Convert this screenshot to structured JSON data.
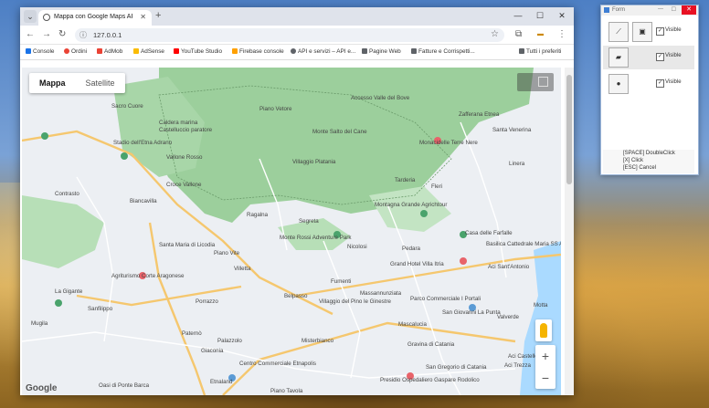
{
  "browser": {
    "tab_title": "Mappa con Google Maps API c",
    "url": "127.0.0.1",
    "bookmarks": [
      "Console",
      "Ordini",
      "AdMob",
      "AdSense",
      "YouTube Studio",
      "Firebase console",
      "API e servizi – API e...",
      "Pagine Web",
      "Fatture e Corrispetti...",
      "Tutti i preferiti"
    ],
    "bookmark_colors": [
      "#1a73e8",
      "#ea4335",
      "#ea4335",
      "#fbbc04",
      "#ff0000",
      "#ffa000",
      "#5f6368",
      "#5f6368",
      "#5f6368",
      "#5f6368"
    ]
  },
  "map": {
    "tabs": [
      "Mappa",
      "Satellite"
    ],
    "zoom_in": "+",
    "zoom_out": "−",
    "google": "Google",
    "labels": [
      {
        "t": "Sacro Cuore"
      },
      {
        "t": "Caldera marina"
      },
      {
        "t": "Castelluccio paratore"
      },
      {
        "t": "Stadio dell'Etna Adrano"
      },
      {
        "t": "Vallone Rosso"
      },
      {
        "t": "Piano Vetore"
      },
      {
        "t": "Monte Salto del Cane"
      },
      {
        "t": "Accesso Valle del Bove"
      },
      {
        "t": "Zafferana Etnea"
      },
      {
        "t": "Santa Venerina"
      },
      {
        "t": "Monacidelle Terre Nere"
      },
      {
        "t": "Villaggio Platania"
      },
      {
        "t": "Tarderia"
      },
      {
        "t": "Contrasto"
      },
      {
        "t": "Biancavilla"
      },
      {
        "t": "Croce Vallone"
      },
      {
        "t": "Ragalna"
      },
      {
        "t": "Segreta"
      },
      {
        "t": "Monte Rossi Adventure Park"
      },
      {
        "t": "Montagna Grande Agrichtour"
      },
      {
        "t": "Casa delle Farfalle"
      },
      {
        "t": "Fleri"
      },
      {
        "t": "Linera"
      },
      {
        "t": "Santa Maria di Licodia"
      },
      {
        "t": "Piano Vite"
      },
      {
        "t": "Nicolosi"
      },
      {
        "t": "Pedara"
      },
      {
        "t": "Basilica Cattedrale Maria SS Annunziata"
      },
      {
        "t": "Agriturismo Corte Aragonese"
      },
      {
        "t": "Villetta"
      },
      {
        "t": "Grand Hotel Villa Itria"
      },
      {
        "t": "Aci Sant'Antonio"
      },
      {
        "t": "La Gigante"
      },
      {
        "t": "Belpasso"
      },
      {
        "t": "Fumenti"
      },
      {
        "t": "Massannunziata"
      },
      {
        "t": "Parco Commerciale I Portali"
      },
      {
        "t": "San Giovanni La Punta"
      },
      {
        "t": "Villaggio del Pino le Ginestre"
      },
      {
        "t": "Porrazzo"
      },
      {
        "t": "Mascalucia"
      },
      {
        "t": "Valverde"
      },
      {
        "t": "Aci Castello"
      },
      {
        "t": "Paternò"
      },
      {
        "t": "Palazzolo"
      },
      {
        "t": "Giaconia"
      },
      {
        "t": "Misterbianco"
      },
      {
        "t": "Gravina di Catania"
      },
      {
        "t": "Aci Trezza"
      },
      {
        "t": "Centro Commerciale Etnapolis"
      },
      {
        "t": "San Gregorio di Catania"
      },
      {
        "t": "Presidio Ospedaliero Gaspare Rodolico"
      },
      {
        "t": "Etnaland"
      },
      {
        "t": "Piano Tavola"
      },
      {
        "t": "Oasi di Ponte Barca"
      },
      {
        "t": "Motta"
      },
      {
        "t": "Mugila"
      },
      {
        "t": "Sanfilippo"
      }
    ]
  },
  "form": {
    "title": "Form",
    "rows": [
      {
        "icon": "line-chart-icon",
        "icon2": "frame-icon",
        "checked": true,
        "label": "Visible"
      },
      {
        "icon": "image-icon",
        "checked": true,
        "label": "Visible"
      },
      {
        "icon": "dot-icon",
        "checked": true,
        "label": "Visible"
      }
    ],
    "help": [
      "[SPACE] DoubleClick",
      "[X] Click",
      "[ESC] Cancel"
    ]
  }
}
